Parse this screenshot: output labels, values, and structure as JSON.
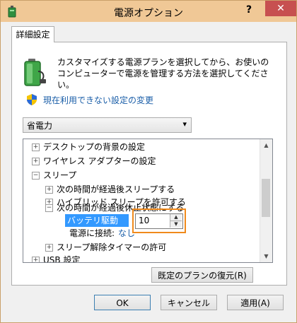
{
  "window": {
    "title": "電源オプション",
    "help_label": "?",
    "close_label": "✕"
  },
  "tab": {
    "label": "詳細設定"
  },
  "description": "カスタマイズする電源プランを選択してから、お使いのコンピューターで電源を管理する方法を選択してください。",
  "change_link": "現在利用できない設定の変更",
  "plan_select": {
    "value": "省電力",
    "arrow": "▾"
  },
  "tree": {
    "items": [
      {
        "expander": "+",
        "label": "デスクトップの背景の設定"
      },
      {
        "expander": "+",
        "label": "ワイヤレス アダプターの設定"
      },
      {
        "expander": "−",
        "label": "スリープ"
      },
      {
        "expander": "+",
        "label": "次の時間が経過後スリープする"
      },
      {
        "expander": "+",
        "label": "ハイブリッド スリープを許可する"
      },
      {
        "expander": "−",
        "label": "次の時間が経過後休止状態にする"
      },
      {
        "expander": "+",
        "label": "スリープ解除タイマーの許可"
      },
      {
        "expander": "+",
        "label": "USB 設定"
      }
    ],
    "battery_label": "バッテリ駆動 (分):",
    "battery_value": "10",
    "ac_label": "電源に接続:",
    "ac_value": "なし"
  },
  "buttons": {
    "restore": "既定のプランの復元(R)",
    "ok": "OK",
    "cancel": "キャンセル",
    "apply": "適用(A)"
  },
  "colors": {
    "titlebar": "#f0c896",
    "close": "#c75050",
    "selection": "#3399ff",
    "highlight_box": "#f08a1c",
    "link": "#1a5ea8"
  },
  "icons": {
    "app": "power-options-icon",
    "battery": "battery-icon",
    "shield": "uac-shield-icon"
  }
}
